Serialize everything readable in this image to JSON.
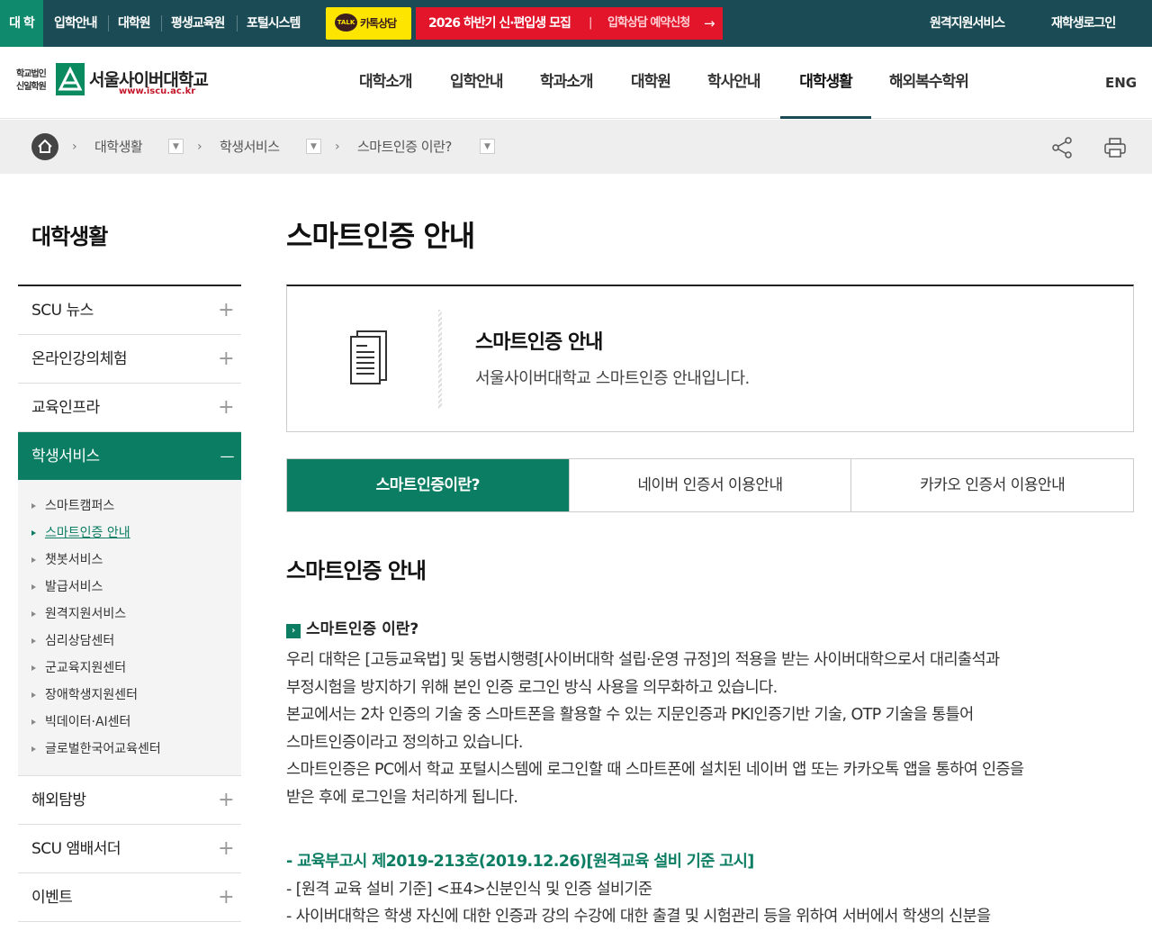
{
  "top_bar": {
    "links": [
      "대 학",
      "입학안내",
      "대학원",
      "평생교육원",
      "포털시스템"
    ],
    "kakao_label": "카톡상담",
    "kakao_badge": "TALK",
    "promo_title": "2026 하반기 신·편입생 모집",
    "promo_divider": "|",
    "promo_cta": "입학상담 예약신청",
    "promo_arrow": "→",
    "right_links": [
      "원격지원서비스",
      "재학생로그인"
    ]
  },
  "header": {
    "logo_small_line1": "학교법인",
    "logo_small_line2": "신일학원",
    "logo_name": "서울사이버대학교",
    "logo_url": "www.iscu.ac.kr",
    "nav": [
      "대학소개",
      "입학안내",
      "학과소개",
      "대학원",
      "학사안내",
      "대학생활",
      "해외복수학위"
    ],
    "active_nav": "대학생활",
    "lang": "ENG"
  },
  "breadcrumb": {
    "items": [
      "대학생활",
      "학생서비스",
      "스마트인증 이란?"
    ]
  },
  "sidebar": {
    "title": "대학생활",
    "items_before": [
      "SCU 뉴스",
      "온라인강의체험",
      "교육인프라"
    ],
    "active_item": "학생서비스",
    "sub_items": [
      "스마트캠퍼스",
      "스마트인증 안내",
      "챗봇서비스",
      "발급서비스",
      "원격지원서비스",
      "심리상담센터",
      "군교육지원센터",
      "장애학생지원센터",
      "빅데이터·AI센터",
      "글로벌한국어교육센터"
    ],
    "active_sub": "스마트인증 안내",
    "items_after": [
      "해외탐방",
      "SCU 앰배서더",
      "이벤트"
    ],
    "plus": "+",
    "minus": "—"
  },
  "content": {
    "page_title": "스마트인증 안내",
    "info_title": "스마트인증 안내",
    "info_desc": "서울사이버대학교 스마트인증 안내입니다.",
    "tabs": [
      "스마트인증이란?",
      "네이버 인증서 이용안내",
      "카카오 인증서 이용안내"
    ],
    "active_tab": "스마트인증이란?",
    "section_title": "스마트인증 안내",
    "sub_title": "스마트인증 이란?",
    "paragraph_lines": [
      "우리 대학은 [고등교육법] 및 동법시행령[사이버대학 설립·운영 규정]의 적용을 받는 사이버대학으로서 대리출석과",
      "부정시험을 방지하기 위해 본인 인증 로그인 방식 사용을 의무화하고 있습니다.",
      "본교에서는 2차 인증의 기술 중 스마트폰을 활용할 수 있는 지문인증과 PKI인증기반 기술, OTP 기술을 통틀어",
      "스마트인증이라고 정의하고 있습니다.",
      "스마트인증은 PC에서 학교 포털시스템에 로그인할 때 스마트폰에 설치된 네이버 앱 또는 카카오톡 앱을 통하여 인증을",
      "받은 후에 로그인을 처리하게 됩니다."
    ],
    "reference_title": "- 교육부고시 제2019-213호(2019.12.26)[원격교육 설비 기준 고시]",
    "reference_line1": "- [원격 교육 설비 기준] <표4>신분인식 및 인증 설비기준",
    "reference_line2": "- 사이버대학은 학생 자신에 대한 인증과 강의 수강에 대한 출결 및 시험관리 등을 위하여 서버에서 학생의 신분을"
  },
  "colors": {
    "top_bar_bg": "#1b4c55",
    "accent_green": "#0a7d62",
    "promo_red": "#e2152b",
    "kakao_yellow": "#fee500"
  }
}
